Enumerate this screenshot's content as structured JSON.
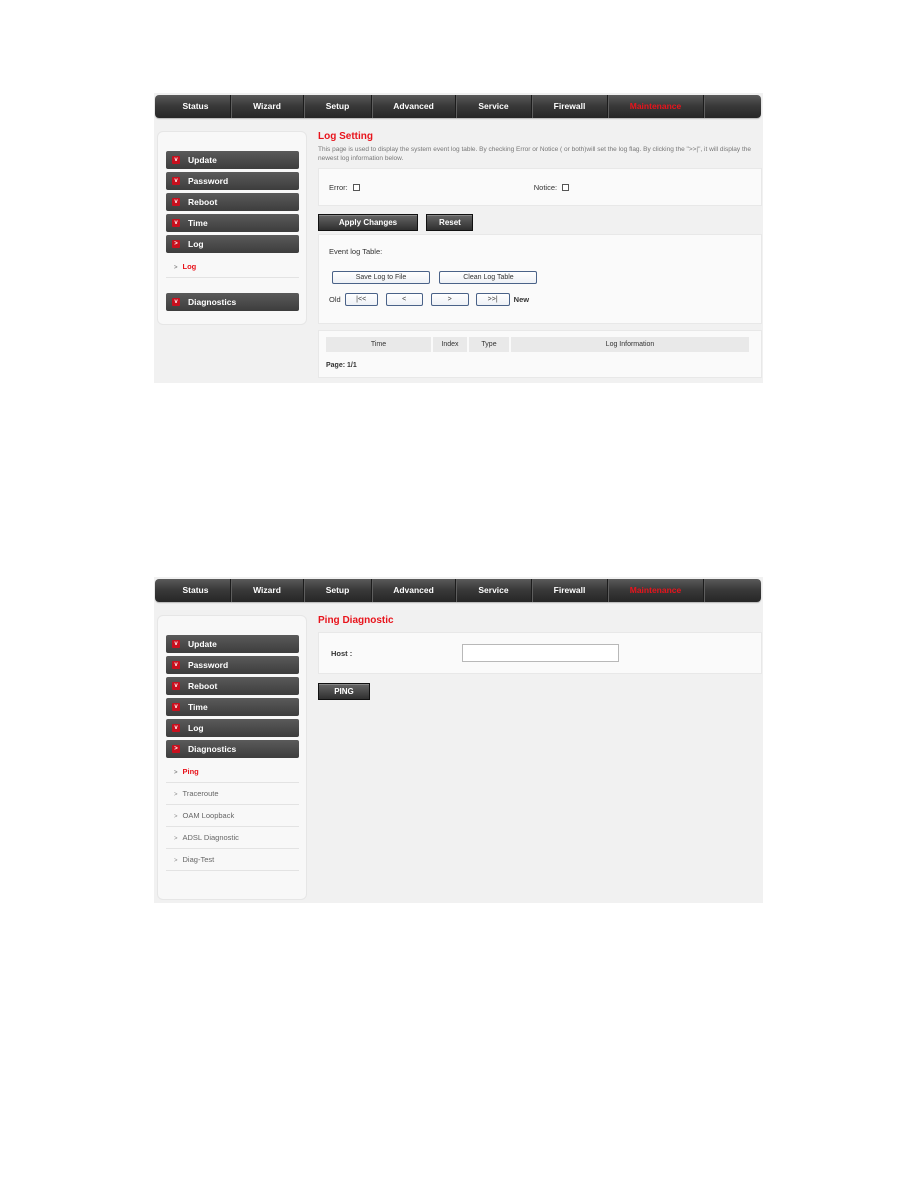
{
  "nav": {
    "items": [
      {
        "label": "Status"
      },
      {
        "label": "Wizard"
      },
      {
        "label": "Setup"
      },
      {
        "label": "Advanced"
      },
      {
        "label": "Service"
      },
      {
        "label": "Firewall"
      },
      {
        "label": "Maintenance"
      }
    ],
    "active_color": "#e8141c"
  },
  "screen1": {
    "sidebar": {
      "menu": [
        {
          "label": "Update"
        },
        {
          "label": "Password"
        },
        {
          "label": "Reboot"
        },
        {
          "label": "Time"
        },
        {
          "label": "Log"
        }
      ],
      "log_sub": [
        {
          "label": "Log"
        }
      ],
      "after": [
        {
          "label": "Diagnostics"
        }
      ]
    },
    "title": "Log Setting",
    "description": "This page is used to display the system event log table. By checking Error or Notice ( or both)will set the log flag. By clicking the \">>|\", it will display the newest log information below.",
    "error_label": "Error:",
    "notice_label": "Notice:",
    "error_checked": false,
    "notice_checked": false,
    "apply_label": "Apply Changes",
    "reset_label": "Reset",
    "event_log_label": "Event log Table:",
    "save_log_label": "Save Log to File",
    "clean_log_label": "Clean Log Table",
    "old_label": "Old",
    "new_label": "New",
    "pager": {
      "first": "|<<",
      "prev": "<",
      "next": ">",
      "last": ">>|"
    },
    "table_headers": [
      "Time",
      "Index",
      "Type",
      "Log Information"
    ],
    "page_info": "Page: 1/1"
  },
  "screen2": {
    "sidebar": {
      "menu": [
        {
          "label": "Update"
        },
        {
          "label": "Password"
        },
        {
          "label": "Reboot"
        },
        {
          "label": "Time"
        },
        {
          "label": "Log"
        },
        {
          "label": "Diagnostics"
        }
      ],
      "diag_sub": [
        {
          "label": "Ping"
        },
        {
          "label": "Traceroute"
        },
        {
          "label": "OAM Loopback"
        },
        {
          "label": "ADSL Diagnostic"
        },
        {
          "label": "Diag-Test"
        }
      ]
    },
    "title": "Ping Diagnostic",
    "host_label": "Host :",
    "host_value": "",
    "ping_label": "PING"
  }
}
